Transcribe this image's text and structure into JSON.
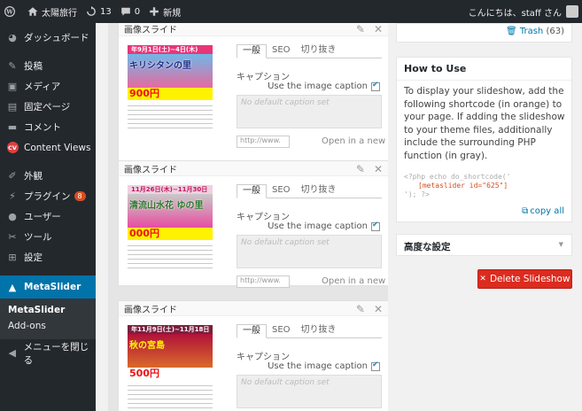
{
  "adminbar": {
    "site_name": "太陽旅行",
    "updates_count": "13",
    "comments_count": "0",
    "new_label": "新規",
    "greeting": "こんにちは、staff さん"
  },
  "sidebar": {
    "items": [
      {
        "label": "ダッシュボード",
        "icon": "dashboard-icon"
      },
      {
        "label": "投稿",
        "icon": "pin-icon"
      },
      {
        "label": "メディア",
        "icon": "media-icon"
      },
      {
        "label": "固定ページ",
        "icon": "page-icon"
      },
      {
        "label": "コメント",
        "icon": "comment-icon"
      },
      {
        "label": "Content Views",
        "icon": "cv-icon"
      },
      {
        "label": "外観",
        "icon": "brush-icon"
      },
      {
        "label": "プラグイン",
        "icon": "plugin-icon",
        "badge": "8"
      },
      {
        "label": "ユーザー",
        "icon": "user-icon"
      },
      {
        "label": "ツール",
        "icon": "wrench-icon"
      },
      {
        "label": "設定",
        "icon": "settings-icon"
      }
    ],
    "current": {
      "label": "MetaSlider",
      "icon": "metaslider-icon"
    },
    "submenu": [
      "MetaSlider",
      "Add-ons"
    ],
    "collapse_label": "メニューを閉じる"
  },
  "slides": [
    {
      "header": "画像スライド",
      "tabs": [
        "一般",
        "SEO",
        "切り抜き"
      ],
      "caption_label": "キャプション",
      "use_caption_label": "Use the image caption",
      "caption_placeholder": "No default caption set",
      "url_value": "http://www.",
      "new_window_label": "Open in a new",
      "flyer": {
        "date": "年9月1日(土)~4日(木)",
        "headline": "キリシタンの里",
        "price": "900円"
      }
    },
    {
      "header": "画像スライド",
      "tabs": [
        "一般",
        "SEO",
        "切り抜き"
      ],
      "caption_label": "キャプション",
      "use_caption_label": "Use the image caption",
      "caption_placeholder": "No default caption set",
      "url_value": "http://www.",
      "new_window_label": "Open in a new",
      "flyer": {
        "date": "11月26日(木)~11月30日(月)",
        "headline": "清流山水花 ゆの里",
        "price": "000円"
      }
    },
    {
      "header": "画像スライド",
      "tabs": [
        "一般",
        "SEO",
        "切り抜き"
      ],
      "caption_label": "キャプション",
      "use_caption_label": "Use the image caption",
      "caption_placeholder": "No default caption set",
      "url_value": "",
      "new_window_label": "",
      "flyer": {
        "date": "年11月9日(土)~11月18日(日)",
        "headline": "秋の宮島",
        "price": "500円"
      }
    }
  ],
  "trash": {
    "label": "Trash",
    "count": "(63)"
  },
  "howto": {
    "title": "How to Use",
    "text": "To display your slideshow, add the following shortcode (in orange) to your page. If adding the slideshow to your theme files, additionally include the surrounding PHP function (in gray).",
    "code_open": "<?php echo do_shortcode('",
    "shortcode": "[metaslider id=\"625\"]",
    "code_close": "'); ?>",
    "copy_all": "copy all"
  },
  "advanced": {
    "title": "高度な設定"
  },
  "delete_button": "Delete Slideshow",
  "colors": {
    "accent": "#0073aa",
    "danger": "#dc2b1f",
    "admin_bg": "#23282d"
  }
}
